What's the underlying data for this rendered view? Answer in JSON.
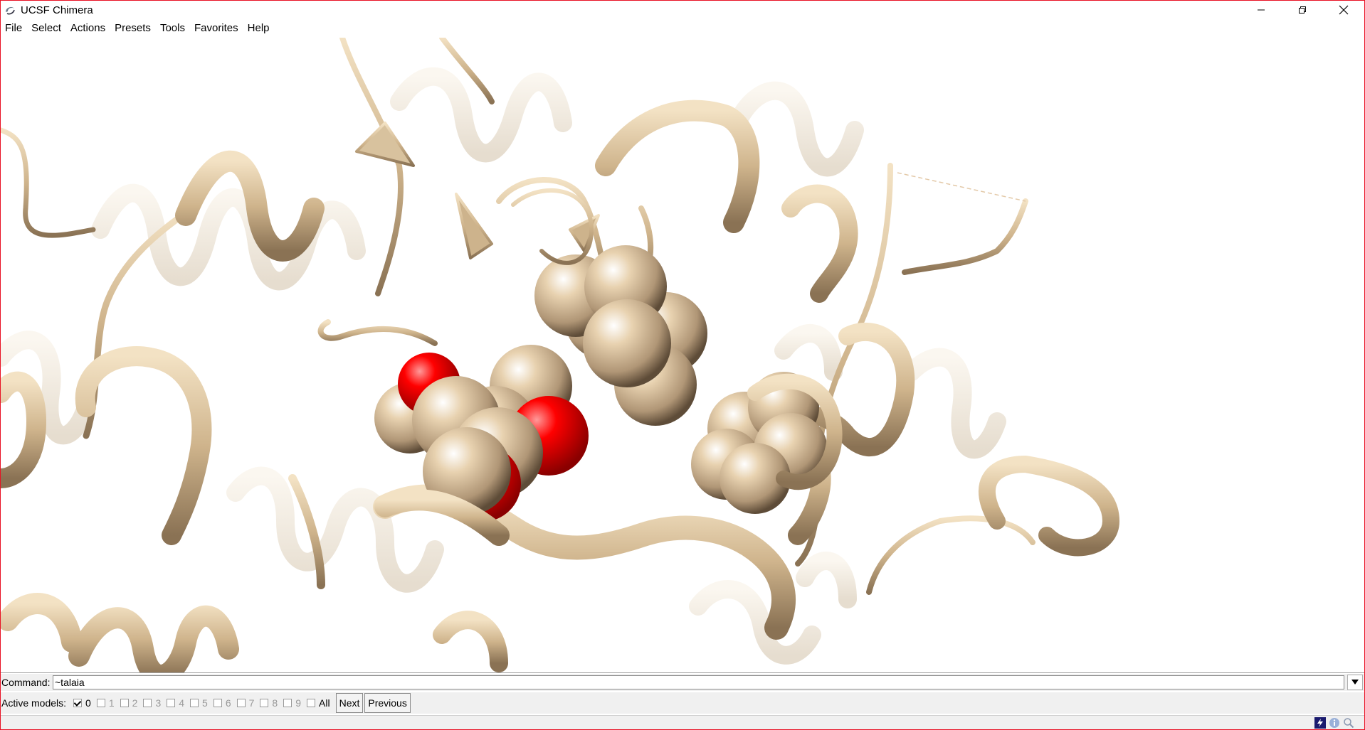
{
  "window": {
    "title": "UCSF Chimera"
  },
  "menu": {
    "items": [
      {
        "label": "File"
      },
      {
        "label": "Select"
      },
      {
        "label": "Actions"
      },
      {
        "label": "Presets"
      },
      {
        "label": "Tools"
      },
      {
        "label": "Favorites"
      },
      {
        "label": "Help"
      }
    ]
  },
  "viewport": {
    "ribbon_color": "#d2b48c",
    "oxygen_color": "#ff0000",
    "background_color": "#ffffff"
  },
  "command": {
    "label": "Command:",
    "value": "~talaia"
  },
  "models": {
    "label": "Active models:",
    "entries": [
      {
        "label": "0",
        "checked": true
      },
      {
        "label": "1",
        "checked": false
      },
      {
        "label": "2",
        "checked": false
      },
      {
        "label": "3",
        "checked": false
      },
      {
        "label": "4",
        "checked": false
      },
      {
        "label": "5",
        "checked": false
      },
      {
        "label": "6",
        "checked": false
      },
      {
        "label": "7",
        "checked": false
      },
      {
        "label": "8",
        "checked": false
      },
      {
        "label": "9",
        "checked": false
      }
    ],
    "all_label": "All",
    "next_label": "Next",
    "previous_label": "Previous"
  },
  "icons": {
    "app": "chimera-icon",
    "minimize": "minimize-icon",
    "restore": "restore-icon",
    "close": "close-icon",
    "dropdown": "chevron-down-icon",
    "status": [
      "lightning-icon",
      "info-icon",
      "magnifier-icon"
    ]
  }
}
